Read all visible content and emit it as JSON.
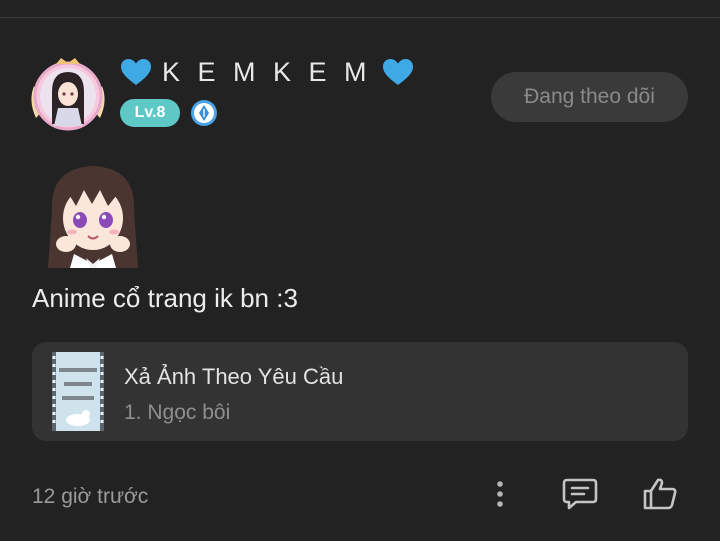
{
  "user": {
    "name": "K E M K E M",
    "level": "Lv.8"
  },
  "follow_button_label": "Đang theo dõi",
  "post": {
    "text": "Anime cổ trang ik bn :3",
    "timestamp": "12 giờ trước"
  },
  "linked_card": {
    "title": "Xả Ảnh Theo Yêu Cầu",
    "subtitle": "1. Ngọc bôi"
  },
  "icons": {
    "heart": "blue-heart-icon",
    "rank": "rank-pen-icon",
    "more": "more-vertical-icon",
    "comment": "comment-icon",
    "like": "thumbs-up-icon"
  },
  "colors": {
    "background": "#222222",
    "level_badge": "#5ec8c6",
    "heart": "#3fa9e6",
    "follow_button_bg": "#3a3a3a",
    "card_bg": "#333333"
  }
}
